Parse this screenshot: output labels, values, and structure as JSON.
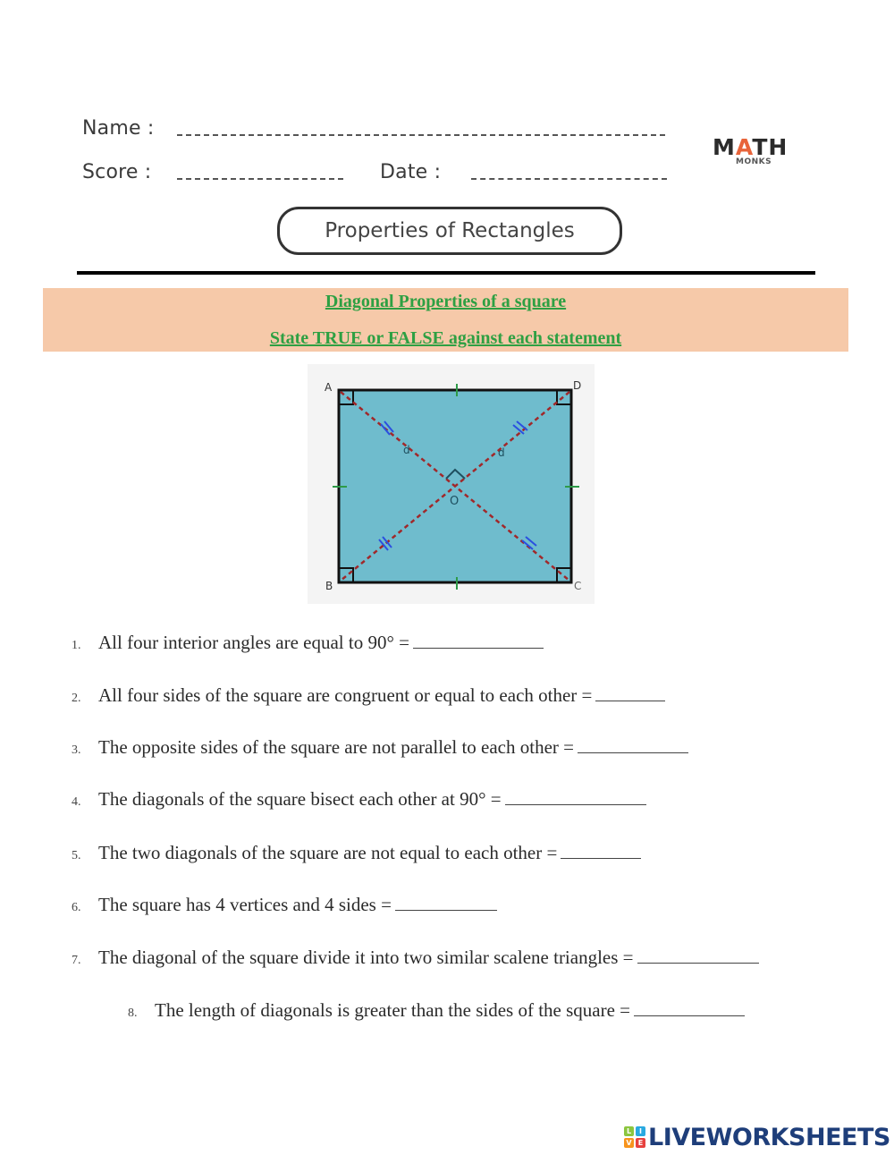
{
  "header": {
    "name_label": "Name :",
    "score_label": "Score :",
    "date_label": "Date :",
    "logo": {
      "math": "MATH",
      "math_prefix": "M",
      "math_a": "A",
      "math_suffix": "TH",
      "sub": "MONKS",
      "accent_color": "#e8643a"
    },
    "title": "Properties of Rectangles"
  },
  "banner": {
    "line1": "Diagonal Properties of a square",
    "line2": "State TRUE or FALSE against each statement",
    "background_color": "#f6c9a9",
    "text_color": "#2ea043"
  },
  "diagram": {
    "vertices": {
      "top_left": "A",
      "top_right": "D",
      "bottom_left": "B",
      "bottom_right": "C",
      "center": "O"
    },
    "diagonal_label": "d",
    "fill_color": "#6fbccd",
    "diagonal_color": "#a0282a",
    "tick_color": "#2e9a48",
    "double_tick_color": "#2a4fe0"
  },
  "questions": [
    {
      "number": "1.",
      "text": "All four interior angles are equal to 90° ="
    },
    {
      "number": "2.",
      "text": "All four sides of the square are congruent or equal to each other ="
    },
    {
      "number": "3.",
      "text": "The opposite sides of the square are  not parallel to each other ="
    },
    {
      "number": "4.",
      "text": "The diagonals of the square bisect each other at 90° ="
    },
    {
      "number": "5.",
      "text": "The two diagonals of the square are  not equal to each other ="
    },
    {
      "number": "6.",
      "text": "The square has 4 vertices and 4 sides ="
    },
    {
      "number": "7.",
      "text": "The diagonal of the square divide it into two similar scalene triangles ="
    },
    {
      "number": "8.",
      "text": "The length of diagonals is greater than the sides of the square ="
    }
  ],
  "footer": {
    "brand": "LIVEWORKSHEETS",
    "tiles": [
      "L",
      "I",
      "V",
      "E"
    ],
    "brand_color": "#1e3e7a"
  }
}
